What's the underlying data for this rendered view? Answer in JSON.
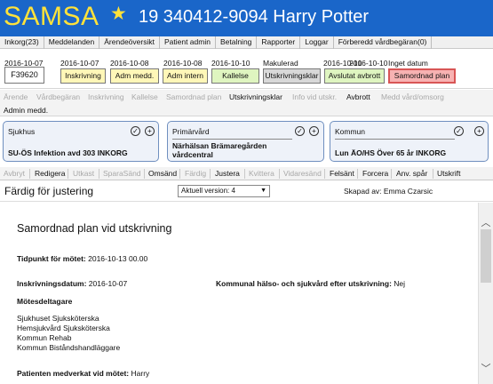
{
  "header": {
    "brand": "SAMSA",
    "star_icon": "star-icon",
    "patient": "19 340412-9094 Harry Potter"
  },
  "menu": [
    "Inkorg(23)",
    "Meddelanden",
    "Ärendeöversikt",
    "Patient admin",
    "Betalning",
    "Rapporter",
    "Loggar",
    "Förberedd vårdbegäran(0)"
  ],
  "timeline": {
    "first_date": "2016-10-07",
    "id": "F39620",
    "items": [
      {
        "date": "2016-10-07",
        "label": "Inskrivning",
        "color": "#fff7b8"
      },
      {
        "date": "2016-10-08",
        "label": "Adm medd.",
        "color": "#fff7b8"
      },
      {
        "date": "2016-10-08",
        "label": "Adm intern",
        "color": "#fff7b8"
      },
      {
        "date": "2016-10-10",
        "label": "Kallelse",
        "color": "#dff5c0"
      },
      {
        "date": "Makulerad",
        "label": "Utskrivningsklar",
        "color": "#d8d8d8"
      },
      {
        "date": "2016-10-10",
        "label": "Avslutat avbrott",
        "color": "#dff5c0"
      },
      {
        "date": "2016-10-10",
        "label": "",
        "color": ""
      },
      {
        "date": "Inget datum",
        "label": "Samordnad plan",
        "color": "#f7b2b2"
      }
    ]
  },
  "steps": {
    "row1": [
      "Ärende",
      "Vårdbegäran",
      "Inskrivning",
      "Kallelse",
      "Samordnad plan",
      "Utskrivningsklar",
      "Info vid utskr.",
      "Avbrott",
      "Medd vård/omsorg"
    ],
    "row2": [
      "Admin medd."
    ]
  },
  "cards": [
    {
      "title": "Sjukhus",
      "value": "SU-ÖS Infektion avd 303 INKORG"
    },
    {
      "title": "Primärvård",
      "value": "Närhälsan Brämaregården vårdcentral"
    },
    {
      "title": "Kommun",
      "value": "Lun ÄO/HS Över 65 år INKORG"
    }
  ],
  "toolbar": [
    "Avbryt",
    "Redigera",
    "Utkast",
    "SparaSänd",
    "Omsänd",
    "Färdig",
    "Justera",
    "Kvittera",
    "Vidaresänd",
    "Felsänt",
    "Forcera",
    "Anv. spår",
    "Utskrift"
  ],
  "status": {
    "text": "Färdig för justering",
    "version": "Aktuell version: 4",
    "author": "Skapad av: Emma Czarsic"
  },
  "document": {
    "title": "Samordnad plan vid utskrivning",
    "meeting_time_label": "Tidpunkt för mötet:",
    "meeting_time_value": "2016-10-13 00.00",
    "admission_label": "Inskrivningsdatum:",
    "admission_value": "2016-10-07",
    "care_label": "Kommunal hälso- och sjukvård efter utskrivning:",
    "care_value": "Nej",
    "participants_label": "Mötesdeltagare",
    "participants": [
      "Sjukhuset Sjuksköterska",
      "Hemsjukvård Sjuksköterska",
      "Kommun Rehab",
      "Kommun Biståndshandläggare"
    ],
    "patient_label": "Patienten medverkat vid mötet:",
    "patient_value": "Harry"
  }
}
